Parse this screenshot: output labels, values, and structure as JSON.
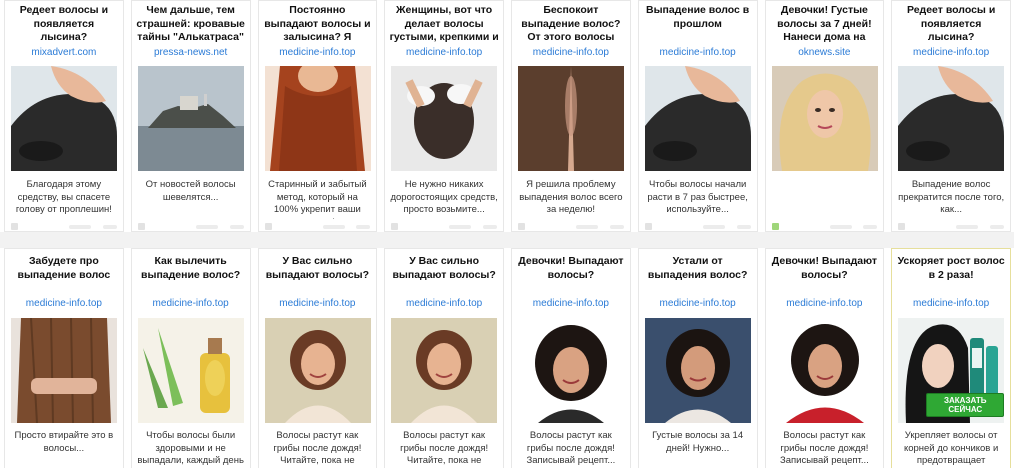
{
  "rows": [
    [
      {
        "title": "Редеет волосы и появляется лысина?",
        "domain": "mixadvert.com",
        "image": "thinning-hair-temple-photo",
        "desc": "Благодаря этому средству, вы спасете голову от проплешин!"
      },
      {
        "title": "Чем дальше, тем страшней: кровавые тайны \"Алькатраса\"",
        "domain": "pressa-news.net",
        "image": "alcatraz-island-photo",
        "desc": "От новостей волосы шевелятся..."
      },
      {
        "title": "Постоянно выпадают волосы и залысина? Я избавилась от",
        "domain": "medicine-info.top",
        "image": "red-hair-photo",
        "desc": "Старинный и забытый метод, который на 100% укрепит ваши волосы!"
      },
      {
        "title": "Женщины, вот что делает волосы густыми, крепкими и",
        "domain": "medicine-info.top",
        "image": "hair-washing-photo",
        "desc": "Не нужно никаких дорогостоящих средств, просто возьмите..."
      },
      {
        "title": "Беспокоит выпадение волос? От этого волосы растут как на",
        "domain": "medicine-info.top",
        "image": "hair-parting-photo",
        "desc": "Я решила проблему выпадения волос всего за неделю!"
      },
      {
        "title": "Выпадение волос в прошлом",
        "domain": "medicine-info.top",
        "image": "thinning-hair-temple-photo",
        "desc": "Чтобы волосы начали расти в 7 раз быстрее, используйте..."
      },
      {
        "title": "Девочки! Густые волосы за 7 дней! Нанеси дома на",
        "domain": "oknews.site",
        "image": "blonde-woman-portrait",
        "desc": ""
      },
      {
        "title": "Редеет волосы и появляется лысина?",
        "domain": "medicine-info.top",
        "image": "thinning-hair-temple-photo",
        "desc": "Выпадение волос прекратится после того, как..."
      }
    ],
    [
      {
        "title": "Забудете про выпадение волос",
        "domain": "medicine-info.top",
        "image": "long-brown-hair-photo",
        "desc": "Просто втирайте это в волосы..."
      },
      {
        "title": "Как вылечить выпадение волос?",
        "domain": "medicine-info.top",
        "image": "aloe-oil-bottle-photo",
        "desc": "Чтобы волосы были здоровыми и не выпадали, каждый день на ночь"
      },
      {
        "title": "У Вас сильно выпадают волосы?",
        "domain": "medicine-info.top",
        "image": "curly-woman-smiling-photo",
        "desc": "Волосы растут как грибы после дождя! Читайте, пока не удалили"
      },
      {
        "title": "У Вас сильно выпадают волосы?",
        "domain": "medicine-info.top",
        "image": "curly-woman-smiling-photo",
        "desc": "Волосы растут как грибы после дождя! Читайте, пока не удалили"
      },
      {
        "title": "Девочки! Выпадают волосы?",
        "domain": "medicine-info.top",
        "image": "dark-curly-woman-photo",
        "desc": "Волосы растут как грибы после дождя! Записывай рецепт..."
      },
      {
        "title": "Устали от выпадения волос?",
        "domain": "medicine-info.top",
        "image": "dark-curly-woman-tv-photo",
        "desc": "Густые волосы за 14 дней! Нужно..."
      },
      {
        "title": "Девочки! Выпадают волосы?",
        "domain": "medicine-info.top",
        "image": "dark-curly-woman-red-photo",
        "desc": "Волосы растут как грибы после дождя! Записывай рецепт..."
      },
      {
        "title": "Ускоряет рост волос в 2 раза!",
        "domain": "medicine-info.top",
        "image": "asian-woman-product-photo",
        "desc": "Укрепляет волосы от корней до кончиков и предотвращает появление седины!",
        "badge": "ЗАКАЗАТЬ СЕЙЧАС",
        "highlight": true
      }
    ]
  ],
  "colors": {
    "link": "#2b7bd6",
    "badge": "#2fa834",
    "highlight_border": "#e6df9c"
  }
}
